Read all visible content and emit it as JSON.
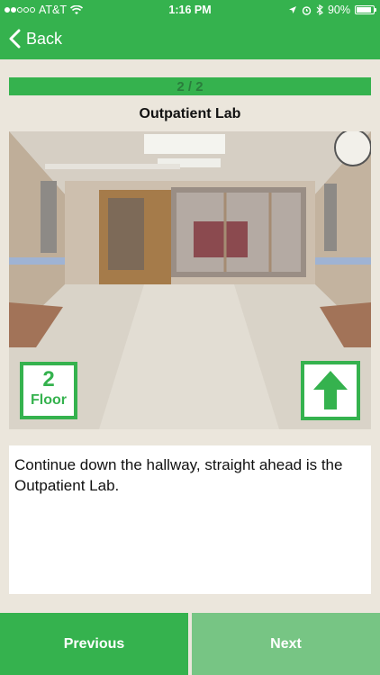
{
  "status_bar": {
    "carrier": "AT&T",
    "time": "1:16 PM",
    "battery_percent": "90%",
    "battery_level": 0.9,
    "signal_bars_filled": 2,
    "signal_bars_total": 5
  },
  "nav": {
    "back_label": "Back"
  },
  "progress": {
    "text": "2 / 2",
    "fraction": 1.0
  },
  "step": {
    "title": "Outpatient Lab",
    "floor_number": "2",
    "floor_label": "Floor",
    "direction_icon": "arrow-up-icon",
    "description": "Continue down the hallway, straight ahead is the Outpatient Lab."
  },
  "footer": {
    "previous_label": "Previous",
    "next_label": "Next"
  },
  "colors": {
    "brand_green": "#35b24e",
    "next_disabled_green": "#77c584",
    "page_background": "#ebe6dc"
  }
}
